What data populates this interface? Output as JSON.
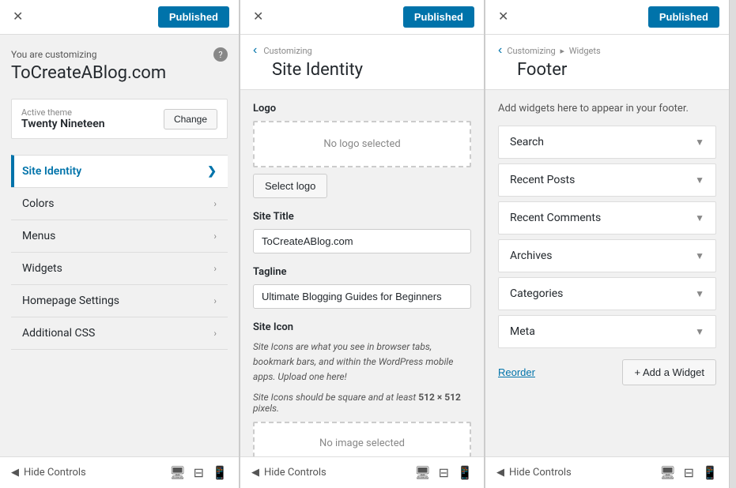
{
  "panel1": {
    "close_label": "✕",
    "published_label": "Published",
    "customizing_prefix": "You are customizing",
    "site_name": "ToCreateABlog.com",
    "help_icon": "?",
    "active_theme_label": "Active theme",
    "active_theme_name": "Twenty Nineteen",
    "change_btn": "Change",
    "nav_items": [
      {
        "id": "site-identity",
        "label": "Site Identity",
        "active": true
      },
      {
        "id": "colors",
        "label": "Colors",
        "active": false
      },
      {
        "id": "menus",
        "label": "Menus",
        "active": false
      },
      {
        "id": "widgets",
        "label": "Widgets",
        "active": false
      },
      {
        "id": "homepage-settings",
        "label": "Homepage Settings",
        "active": false
      },
      {
        "id": "additional-css",
        "label": "Additional CSS",
        "active": false
      }
    ],
    "hide_controls": "Hide Controls",
    "device_icons": [
      "🖥",
      "⊟",
      "📱"
    ]
  },
  "panel2": {
    "close_label": "✕",
    "published_label": "Published",
    "back_arrow": "‹",
    "breadcrumb": "Customizing",
    "section_title": "Site Identity",
    "logo_section_label": "Logo",
    "logo_placeholder": "No logo selected",
    "select_logo_btn": "Select logo",
    "site_title_label": "Site Title",
    "site_title_value": "ToCreateABlog.com",
    "tagline_label": "Tagline",
    "tagline_value": "Ultimate Blogging Guides for Beginners",
    "site_icon_label": "Site Icon",
    "site_icon_desc": "Site Icons are what you see in browser tabs, bookmark bars, and within the WordPress mobile apps. Upload one here!",
    "site_icon_size": "Site Icons should be square and at least",
    "site_icon_size_bold": "512 × 512",
    "site_icon_size_end": "pixels.",
    "no_image_label": "No image selected",
    "hide_controls": "Hide Controls"
  },
  "panel3": {
    "close_label": "✕",
    "published_label": "Published",
    "back_arrow": "‹",
    "breadcrumb_1": "Customizing",
    "breadcrumb_sep": "▸",
    "breadcrumb_2": "Widgets",
    "section_title": "Footer",
    "widgets_desc": "Add widgets here to appear in your footer.",
    "widgets": [
      {
        "label": "Search"
      },
      {
        "label": "Recent Posts"
      },
      {
        "label": "Recent Comments"
      },
      {
        "label": "Archives"
      },
      {
        "label": "Categories"
      },
      {
        "label": "Meta"
      }
    ],
    "reorder_btn": "Reorder",
    "add_widget_btn": "+ Add a Widget",
    "hide_controls": "Hide Controls"
  }
}
